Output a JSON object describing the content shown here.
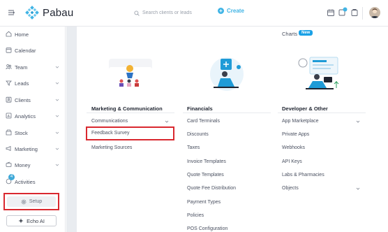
{
  "header": {
    "logo_text": "Pabau",
    "search_placeholder": "Search clients or leads",
    "create_label": "Create",
    "icons": [
      "calendar-icon",
      "notifications-icon",
      "tasks-icon"
    ]
  },
  "sidebar": {
    "items": [
      {
        "label": "Home",
        "icon": "home-icon",
        "chevron": false
      },
      {
        "label": "Calendar",
        "icon": "calendar-icon",
        "chevron": false
      },
      {
        "label": "Team",
        "icon": "team-icon",
        "chevron": true
      },
      {
        "label": "Leads",
        "icon": "leads-icon",
        "chevron": true
      },
      {
        "label": "Clients",
        "icon": "clients-icon",
        "chevron": true
      },
      {
        "label": "Analytics",
        "icon": "analytics-icon",
        "chevron": true
      },
      {
        "label": "Stock",
        "icon": "stock-icon",
        "chevron": true
      },
      {
        "label": "Marketing",
        "icon": "marketing-icon",
        "chevron": true
      },
      {
        "label": "Money",
        "icon": "money-icon",
        "chevron": true
      },
      {
        "label": "Activities",
        "icon": "activities-icon",
        "chevron": false
      }
    ],
    "activities_badge": "4",
    "setup_label": "Setup",
    "echo_label": "Echo AI"
  },
  "main": {
    "charts_label": "Charts",
    "new_badge": "New",
    "columns": [
      {
        "title": "Marketing & Communication",
        "links": [
          {
            "label": "Communications",
            "chevron": true
          },
          {
            "label": "Feedback Survey",
            "chevron": false
          },
          {
            "label": "Marketing Sources",
            "chevron": false
          }
        ]
      },
      {
        "title": "Financials",
        "links": [
          {
            "label": "Card Terminals",
            "chevron": false
          },
          {
            "label": "Discounts",
            "chevron": false
          },
          {
            "label": "Taxes",
            "chevron": false
          },
          {
            "label": "Invoice Templates",
            "chevron": false
          },
          {
            "label": "Quote Templates",
            "chevron": false
          },
          {
            "label": "Quote Fee Distribution",
            "chevron": false
          },
          {
            "label": "Payment Types",
            "chevron": false
          },
          {
            "label": "Policies",
            "chevron": false
          },
          {
            "label": "POS Configuration",
            "chevron": false
          }
        ]
      },
      {
        "title": "Developer & Other",
        "links": [
          {
            "label": "App Marketplace",
            "chevron": true
          },
          {
            "label": "Private Apps",
            "chevron": false
          },
          {
            "label": "Webhooks",
            "chevron": false
          },
          {
            "label": "API Keys",
            "chevron": false
          },
          {
            "label": "Labs & Pharmacies",
            "chevron": false
          },
          {
            "label": "Objects",
            "chevron": true
          }
        ]
      }
    ]
  },
  "colors": {
    "brand": "#40b4e5",
    "highlight": "#d9282f",
    "new_badge": "#1aa1e6"
  }
}
